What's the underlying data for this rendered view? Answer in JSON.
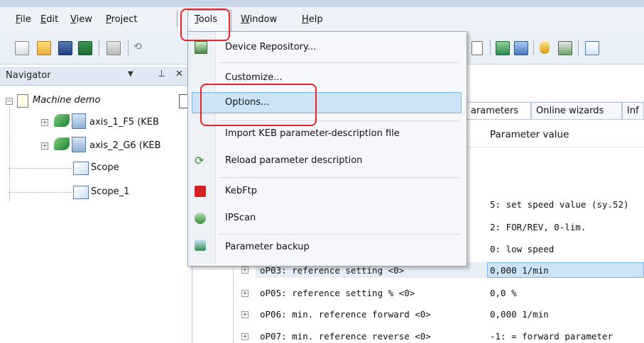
{
  "menubar": {
    "items": [
      {
        "label": "File",
        "u": "F",
        "rest": "ile"
      },
      {
        "label": "Edit",
        "u": "E",
        "rest": "dit"
      },
      {
        "label": "View",
        "u": "V",
        "rest": "iew"
      },
      {
        "label": "Project",
        "u": "P",
        "rest": "roject"
      },
      {
        "label": "Tools",
        "u": "T",
        "rest": "ools"
      },
      {
        "label": "Window",
        "u": "W",
        "rest": "indow"
      },
      {
        "label": "Help",
        "u": "H",
        "rest": "elp"
      }
    ]
  },
  "navigator": {
    "title": "Navigator",
    "close": "✕",
    "pin": "⊥",
    "tree": {
      "root": "Machine demo",
      "axis1": "axis_1_F5 (KEB",
      "axis2": "axis_2_G6 (KEB",
      "scope": "Scope",
      "scope1": "Scope_1"
    }
  },
  "tools_menu": {
    "items": [
      {
        "label": "Device Repository...",
        "icon": "device-repository-icon"
      },
      {
        "label": "Customize...",
        "icon": ""
      },
      {
        "label": "Options...",
        "icon": ""
      },
      {
        "label": "Import KEB parameter-description file",
        "icon": ""
      },
      {
        "label": "Reload parameter description",
        "icon": "reload-icon"
      },
      {
        "label": "KebFtp",
        "icon": "kebftp-icon"
      },
      {
        "label": "IPScan",
        "icon": "ipscan-shield-icon"
      },
      {
        "label": "Parameter backup",
        "icon": "parameter-backup-icon"
      }
    ]
  },
  "tabs": {
    "parameters": "arameters",
    "online_wizards": "Online wizards",
    "info": "Inf"
  },
  "grid": {
    "col_header": "Parameter value",
    "values": [
      "5: set speed value (sy.52)",
      "2: FOR/REV, 0-lim.",
      "0: low speed"
    ],
    "rows": [
      {
        "name": "oP03: reference setting <0>",
        "value": "0,000 1/min"
      },
      {
        "name": "oP05: reference setting % <0>",
        "value": "0,0 %"
      },
      {
        "name": "oP06: min. reference forward <0>",
        "value": "0,000 1/min"
      },
      {
        "name": "oP07: min. reference reverse <0>",
        "value": "-1: = forward parameter"
      }
    ]
  },
  "colors": {
    "highlight": "#cde4f7",
    "annotation_red": "#e8242a"
  }
}
